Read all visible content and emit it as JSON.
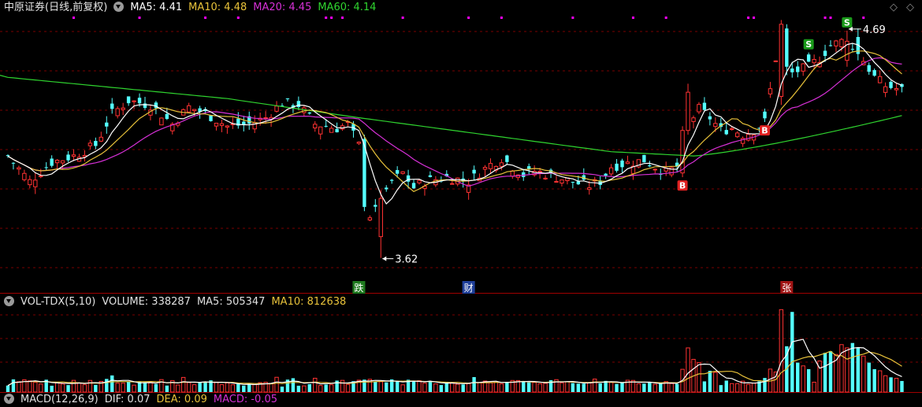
{
  "header": {
    "stock_name": "中原证券(日线,前复权)",
    "ma": [
      {
        "label": "MA5: 4.41",
        "color": "#ffffff"
      },
      {
        "label": "MA10: 4.48",
        "color": "#e8c23a"
      },
      {
        "label": "MA20: 4.45",
        "color": "#d630d6"
      },
      {
        "label": "MA60: 4.14",
        "color": "#2fd42f"
      }
    ],
    "dropdown_icon": "triangle-down-icon",
    "window_icons": [
      "diamond-icon",
      "diamond-icon"
    ]
  },
  "volume_header": {
    "name": "VOL-TDX(5,10)",
    "volume": "VOLUME: 338287",
    "ma5": "MA5: 505347",
    "ma10": "MA10: 812638"
  },
  "macd_header": {
    "name": "MACD(12,26,9)",
    "dif": "DIF: 0.07",
    "dea": "DEA: 0.09",
    "macd": "MACD: -0.05"
  },
  "colors": {
    "up": "#ff3232",
    "down": "#54ffff",
    "ma5": "#ffffff",
    "ma10": "#e8c23a",
    "ma20": "#d630d6",
    "ma60": "#2fd42f",
    "grid": "#7a0000",
    "marker": "#ff00ff"
  },
  "chart_data": {
    "type": "candlestick",
    "price_annotations": {
      "high": "4.69",
      "low": "3.62"
    },
    "ma_last": {
      "ma5": 4.41,
      "ma10": 4.48,
      "ma20": 4.45,
      "ma60": 4.14
    },
    "signals": [
      {
        "label": "S",
        "kind": "sell",
        "index": 146
      },
      {
        "label": "S",
        "kind": "sell",
        "index": 153
      },
      {
        "label": "B",
        "kind": "buy",
        "index": 123
      },
      {
        "label": "B",
        "kind": "buy",
        "index": 138
      }
    ],
    "events": [
      {
        "label": "跌",
        "index": 64
      },
      {
        "label": "财",
        "index": 84
      },
      {
        "label": "张",
        "index": 142
      }
    ],
    "volume_last": {
      "volume": 338287,
      "ma5": 505347,
      "ma10": 812638
    },
    "macd_last": {
      "dif": 0.07,
      "dea": 0.09,
      "macd": -0.05
    }
  }
}
